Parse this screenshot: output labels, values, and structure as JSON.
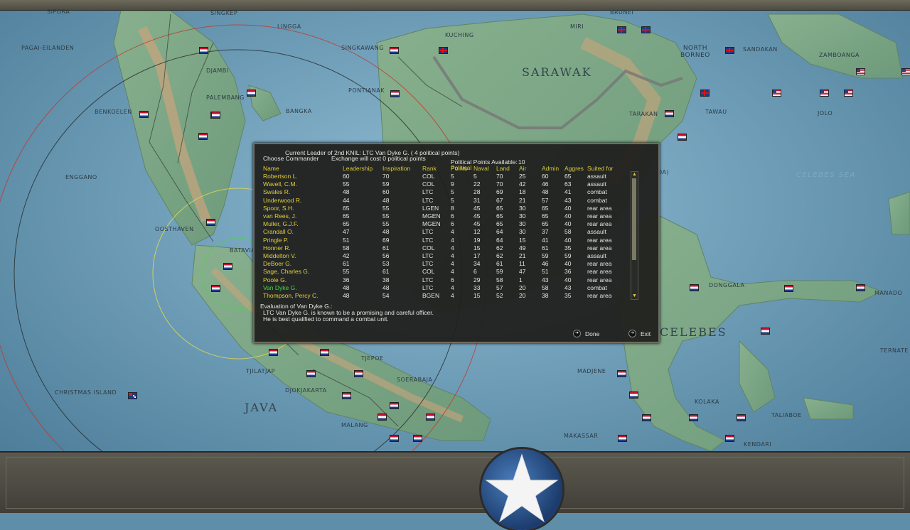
{
  "map": {
    "labels": {
      "sipora": "SIPORA",
      "singkep": "SINGKEP",
      "lingga": "LINGGA",
      "kuching": "KUCHING",
      "miri": "MIRI",
      "brunei": "BRUNEI",
      "pagai": "PAGAI-EILANDEN",
      "djambi": "DJAMBI",
      "singkawang": "SINGKAWANG",
      "sarawak": "SARAWAK",
      "north_borneo": "NORTH\nBORNEO",
      "sandakan": "SANDAKAN",
      "zamboanga": "ZAMBOANGA",
      "palembang": "PALEMBANG",
      "pontianak": "PONTIANAK",
      "benkoelen": "BENKOELEN",
      "bangka": "BANGKA",
      "tarakan": "TARAKAN",
      "tawau": "TAWAU",
      "jolo": "JOLO",
      "enggano": "ENGGANO",
      "celebes_sea": "CELEBES SEA",
      "oosthaven": "OOSTHAVEN",
      "batavia": "BATAVIA",
      "donggala": "DONGGALA",
      "manado": "MANADO",
      "celebes": "CELEBES",
      "ternate": "TERNATE",
      "tjepoe": "TJEPOE",
      "tjilatjap": "TJILATJAP",
      "soerabaja": "SOERABAJA",
      "christmas": "CHRISTMAS ISLAND",
      "djokjakarta": "DJOKJAKARTA",
      "madjene": "MADJENE",
      "java": "JAVA",
      "malang": "MALANG",
      "kolaka": "KOLAKA",
      "taliabo": "TALIABOE",
      "makassar": "MAKASSAR",
      "kendari": "KENDARI",
      "da": "DA)"
    },
    "colors": {
      "sea": "#5f8ea8",
      "land": "#7fa888",
      "mountain": "#c4a27a"
    }
  },
  "dialog": {
    "current_leader": "Current Leader of 2nd KNIL: LTC Van Dyke G. ( 4 political points)",
    "choose": "Choose Commander",
    "exchange": "Exchange will cost 0 political points",
    "pp_label": "Political Points Available:",
    "pp_value": "10",
    "headers": {
      "name": "Name",
      "leadership": "Leadership",
      "inspiration": "Inspiration",
      "rank": "Rank",
      "political": "Political",
      "points": "Points",
      "naval": "Naval",
      "land": "Land",
      "air": "Air",
      "admin": "Admin",
      "aggres": "Aggres",
      "suited": "Suited for"
    },
    "rows": [
      {
        "name": "Robertson L.",
        "lead": "60",
        "insp": "70",
        "rank": "COL",
        "pts": "5",
        "naval": "5",
        "land": "70",
        "air": "25",
        "admin": "60",
        "aggr": "65",
        "suit": "assault"
      },
      {
        "name": "Wavell, C.M.",
        "lead": "55",
        "insp": "59",
        "rank": "COL",
        "pts": "9",
        "naval": "22",
        "land": "70",
        "air": "42",
        "admin": "46",
        "aggr": "63",
        "suit": "assault"
      },
      {
        "name": "Swales R.",
        "lead": "48",
        "insp": "60",
        "rank": "LTC",
        "pts": "5",
        "naval": "28",
        "land": "69",
        "air": "18",
        "admin": "48",
        "aggr": "41",
        "suit": "combat"
      },
      {
        "name": "Underwood R.",
        "lead": "44",
        "insp": "48",
        "rank": "LTC",
        "pts": "5",
        "naval": "31",
        "land": "67",
        "air": "21",
        "admin": "57",
        "aggr": "43",
        "suit": "combat"
      },
      {
        "name": "Spoor, S.H.",
        "lead": "65",
        "insp": "55",
        "rank": "LGEN",
        "pts": "8",
        "naval": "45",
        "land": "65",
        "air": "30",
        "admin": "65",
        "aggr": "40",
        "suit": "rear area"
      },
      {
        "name": "van Rees, J.",
        "lead": "65",
        "insp": "55",
        "rank": "MGEN",
        "pts": "6",
        "naval": "45",
        "land": "65",
        "air": "30",
        "admin": "65",
        "aggr": "40",
        "suit": "rear area"
      },
      {
        "name": "Muller, G.J.F.",
        "lead": "65",
        "insp": "55",
        "rank": "MGEN",
        "pts": "6",
        "naval": "45",
        "land": "65",
        "air": "30",
        "admin": "65",
        "aggr": "40",
        "suit": "rear area"
      },
      {
        "name": "Crandall O.",
        "lead": "47",
        "insp": "48",
        "rank": "LTC",
        "pts": "4",
        "naval": "12",
        "land": "64",
        "air": "30",
        "admin": "37",
        "aggr": "58",
        "suit": "assault"
      },
      {
        "name": "Pringle P.",
        "lead": "51",
        "insp": "69",
        "rank": "LTC",
        "pts": "4",
        "naval": "19",
        "land": "64",
        "air": "15",
        "admin": "41",
        "aggr": "40",
        "suit": "rear area"
      },
      {
        "name": "Honner R.",
        "lead": "58",
        "insp": "61",
        "rank": "COL",
        "pts": "4",
        "naval": "15",
        "land": "62",
        "air": "49",
        "admin": "61",
        "aggr": "35",
        "suit": "rear area"
      },
      {
        "name": "Middelton V.",
        "lead": "42",
        "insp": "56",
        "rank": "LTC",
        "pts": "4",
        "naval": "17",
        "land": "62",
        "air": "21",
        "admin": "59",
        "aggr": "59",
        "suit": "assault"
      },
      {
        "name": "DeBoer G.",
        "lead": "61",
        "insp": "53",
        "rank": "LTC",
        "pts": "4",
        "naval": "34",
        "land": "61",
        "air": "11",
        "admin": "46",
        "aggr": "40",
        "suit": "rear area"
      },
      {
        "name": "Sage, Charles G.",
        "lead": "55",
        "insp": "61",
        "rank": "COL",
        "pts": "4",
        "naval": "6",
        "land": "59",
        "air": "47",
        "admin": "51",
        "aggr": "36",
        "suit": "rear area"
      },
      {
        "name": "Poole G.",
        "lead": "36",
        "insp": "38",
        "rank": "LTC",
        "pts": "6",
        "naval": "29",
        "land": "58",
        "air": "1",
        "admin": "43",
        "aggr": "40",
        "suit": "rear area"
      },
      {
        "name": "Van Dyke G.",
        "lead": "48",
        "insp": "48",
        "rank": "LTC",
        "pts": "4",
        "naval": "33",
        "land": "57",
        "air": "20",
        "admin": "58",
        "aggr": "43",
        "suit": "combat",
        "selected": true
      },
      {
        "name": "Thompson, Percy C.",
        "lead": "48",
        "insp": "54",
        "rank": "BGEN",
        "pts": "4",
        "naval": "15",
        "land": "52",
        "air": "20",
        "admin": "38",
        "aggr": "35",
        "suit": "rear area"
      }
    ],
    "eval_title": "Evaluation of Van Dyke G.:",
    "eval_line1": "LTC Van Dyke G. is known to be a promising and careful officer.",
    "eval_line2": "He is best qualified to command a combat unit.",
    "done": "Done",
    "exit": "Exit"
  }
}
